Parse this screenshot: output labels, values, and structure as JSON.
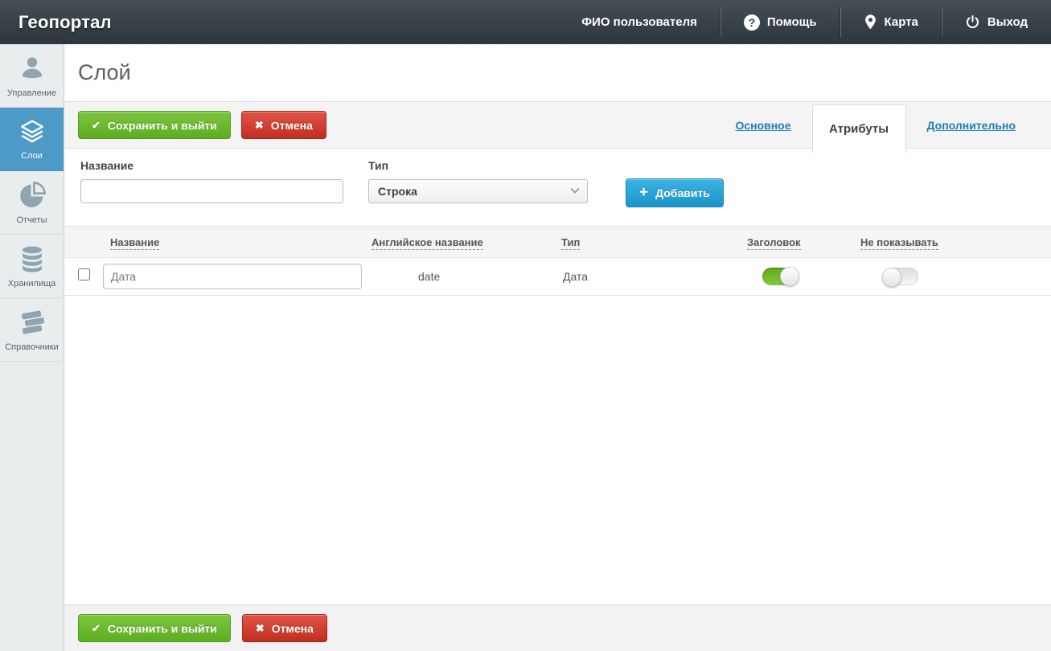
{
  "topbar": {
    "brand": "Геопортал",
    "user_label": "ФИО пользователя",
    "help_label": "Помощь",
    "map_label": "Карта",
    "exit_label": "Выход"
  },
  "sidebar": {
    "items": [
      {
        "label": "Управление",
        "icon": "user-icon",
        "active": false
      },
      {
        "label": "Слои",
        "icon": "layers-icon",
        "active": true
      },
      {
        "label": "Отчеты",
        "icon": "pie-chart-icon",
        "active": false
      },
      {
        "label": "Хранилища",
        "icon": "database-icon",
        "active": false
      },
      {
        "label": "Справочники",
        "icon": "books-icon",
        "active": false
      }
    ]
  },
  "page": {
    "title": "Слой"
  },
  "actions": {
    "save_label": "Сохранить и выйти",
    "cancel_label": "Отмена",
    "save_icon": "✔",
    "cancel_icon": "✖"
  },
  "tabs": {
    "items": [
      {
        "label": "Основное",
        "active": false
      },
      {
        "label": "Атрибуты",
        "active": true
      },
      {
        "label": "Дополнительно",
        "active": false
      }
    ]
  },
  "attribute_form": {
    "name_label": "Название",
    "name_value": "",
    "name_placeholder": "",
    "type_label": "Тип",
    "type_value": "Строка",
    "add_label": "Добавить",
    "add_icon": "+"
  },
  "attributes_table": {
    "headers": {
      "name": "Название",
      "english_name": "Английское название",
      "type": "Тип",
      "header": "Заголовок",
      "hide": "Не показывать"
    },
    "rows": [
      {
        "name": "Дата",
        "english_name": "date",
        "type": "Дата",
        "is_header": true,
        "is_hidden": false,
        "selected": false
      }
    ]
  },
  "colors": {
    "topbar_dark": "#343d42",
    "sidebar_active_blue": "#4d9ac7",
    "link_blue": "#1e7db6",
    "button_green": "#5dad1f",
    "button_red": "#c12e21",
    "button_blue": "#1a93c8",
    "toggle_on_green": "#71bb2c"
  }
}
